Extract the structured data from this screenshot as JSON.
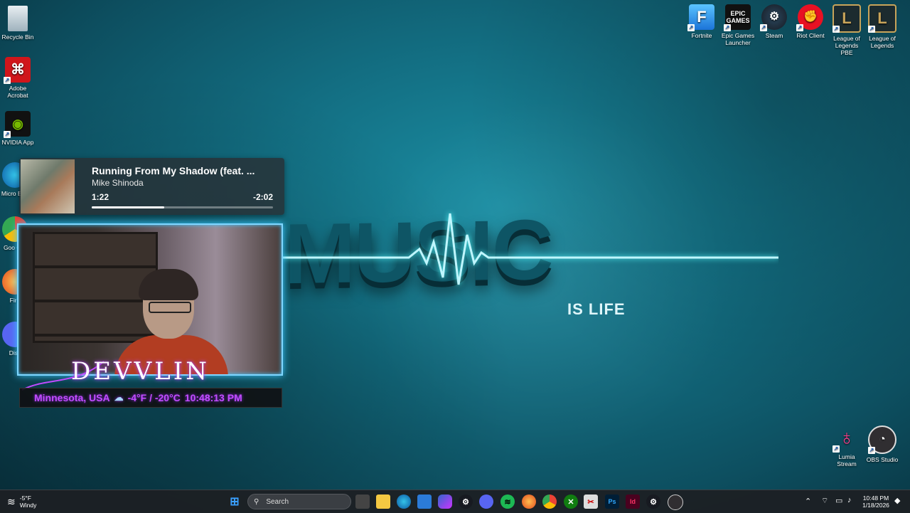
{
  "desktop": {
    "left_icons": [
      {
        "label": "Recycle Bin",
        "icon": "recycle-bin-icon"
      },
      {
        "label": "Adobe Acrobat",
        "icon": "acrobat-icon"
      },
      {
        "label": "NVIDIA App",
        "icon": "nvidia-icon"
      },
      {
        "label": "Micro Edg",
        "icon": "edge-icon"
      },
      {
        "label": "Goo Chr",
        "icon": "chrome-icon"
      },
      {
        "label": "Fire",
        "icon": "firefox-icon"
      },
      {
        "label": "Disc",
        "icon": "discord-icon"
      }
    ],
    "top_right_icons": [
      {
        "label": "Fortnite",
        "icon": "fortnite-icon"
      },
      {
        "label": "Epic Games Launcher",
        "icon": "epic-games-icon"
      },
      {
        "label": "Steam",
        "icon": "steam-icon"
      },
      {
        "label": "Riot Client",
        "icon": "riot-client-icon"
      },
      {
        "label": "League of Legends PBE",
        "icon": "league-pbe-icon"
      },
      {
        "label": "League of Legends",
        "icon": "league-icon"
      }
    ],
    "bottom_right_icons": [
      {
        "label": "Lumia Stream",
        "icon": "lumia-stream-icon"
      },
      {
        "label": "OBS Studio",
        "icon": "obs-icon"
      }
    ]
  },
  "wallpaper": {
    "main_text": "MUSIC",
    "sub_text": "IS LIFE"
  },
  "now_playing": {
    "title": "Running From My Shadow (feat. ...",
    "artist": "Mike Shinoda",
    "elapsed": "1:22",
    "remaining": "-2:02",
    "progress": 0.4
  },
  "overlay": {
    "name": "DEVVLIN",
    "location": "Minnesota, USA",
    "temperature": "-4°F / -20°C",
    "clock": "10:48:13 PM"
  },
  "taskbar": {
    "weather_temp": "-5°F",
    "weather_desc": "Windy",
    "search_placeholder": "Search",
    "time": "10:48 PM",
    "date": "1/18/2026",
    "apps": [
      "start-icon",
      "search",
      "task-view-icon",
      "file-explorer-icon",
      "edge-icon",
      "store-icon",
      "copilot-icon",
      "steam-icon",
      "discord-icon",
      "spotify-icon",
      "firefox-icon",
      "chrome-icon",
      "xbox-icon",
      "snipping-tool-icon",
      "photoshop-icon",
      "indesign-icon",
      "steam-alt-icon",
      "obs-icon"
    ]
  }
}
